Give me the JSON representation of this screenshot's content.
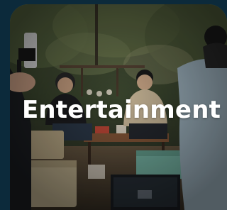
{
  "category_card": {
    "title": "Entertainment"
  }
}
